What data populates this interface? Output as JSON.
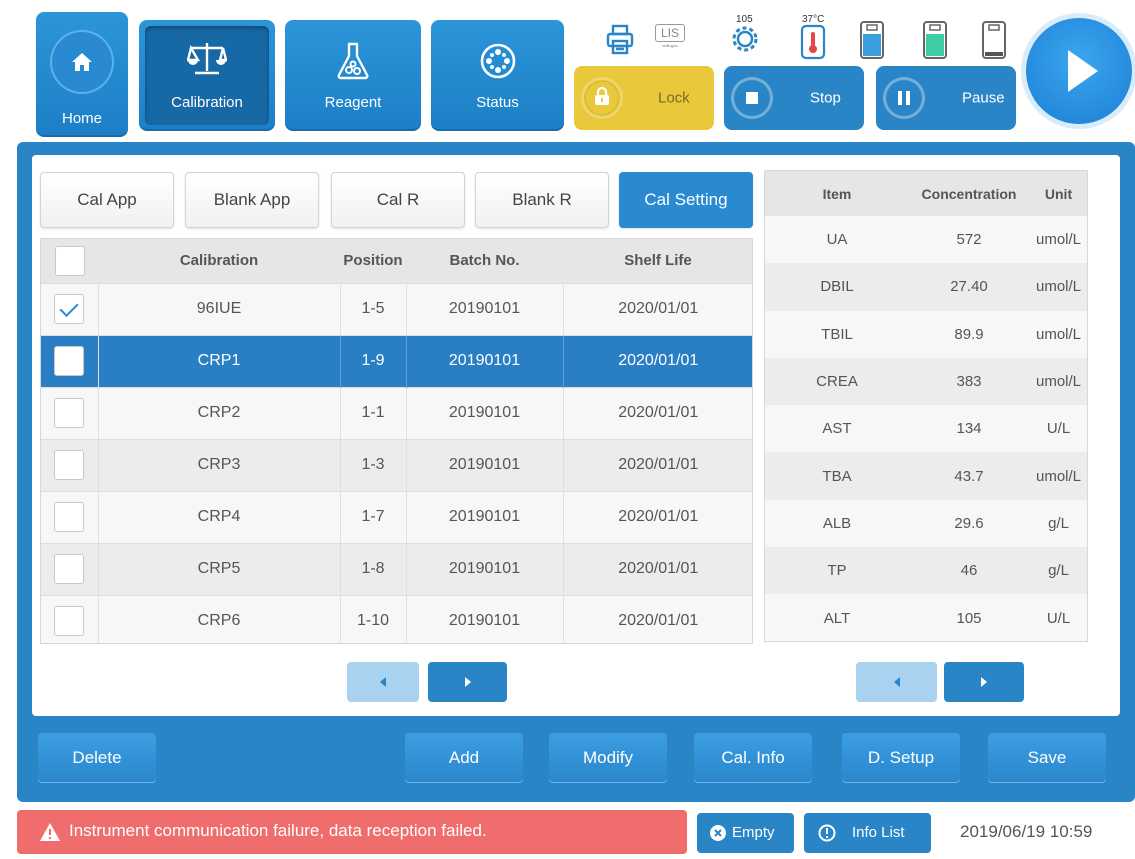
{
  "nav": {
    "home": "Home",
    "calibration": "Calibration",
    "reagent": "Reagent",
    "status": "Status"
  },
  "icons": {
    "lis": "LIS",
    "temp_small": "105",
    "temp_37": "37°C"
  },
  "controls": {
    "lock": "Lock",
    "stop": "Stop",
    "pause": "Pause"
  },
  "tabs": [
    "Cal App",
    "Blank App",
    "Cal R",
    "Blank R",
    "Cal Setting"
  ],
  "cal_table": {
    "headers": [
      "Calibration",
      "Position",
      "Batch No.",
      "Shelf Life"
    ],
    "rows": [
      {
        "name": "96IUE",
        "position": "1-5",
        "batch": "20190101",
        "shelf": "2020/01/01",
        "checked": true
      },
      {
        "name": "CRP1",
        "position": "1-9",
        "batch": "20190101",
        "shelf": "2020/01/01",
        "checked": false
      },
      {
        "name": "CRP2",
        "position": "1-1",
        "batch": "20190101",
        "shelf": "2020/01/01",
        "checked": false
      },
      {
        "name": "CRP3",
        "position": "1-3",
        "batch": "20190101",
        "shelf": "2020/01/01",
        "checked": false
      },
      {
        "name": "CRP4",
        "position": "1-7",
        "batch": "20190101",
        "shelf": "2020/01/01",
        "checked": false
      },
      {
        "name": "CRP5",
        "position": "1-8",
        "batch": "20190101",
        "shelf": "2020/01/01",
        "checked": false
      },
      {
        "name": "CRP6",
        "position": "1-10",
        "batch": "20190101",
        "shelf": "2020/01/01",
        "checked": false
      }
    ]
  },
  "item_table": {
    "headers": [
      "Item",
      "Concentration",
      "Unit"
    ],
    "rows": [
      {
        "item": "UA",
        "conc": "572",
        "unit": "umol/L"
      },
      {
        "item": "DBIL",
        "conc": "27.40",
        "unit": "umol/L"
      },
      {
        "item": "TBIL",
        "conc": "89.9",
        "unit": "umol/L"
      },
      {
        "item": "CREA",
        "conc": "383",
        "unit": "umol/L"
      },
      {
        "item": "AST",
        "conc": "134",
        "unit": "U/L"
      },
      {
        "item": "TBA",
        "conc": "43.7",
        "unit": "umol/L"
      },
      {
        "item": "ALB",
        "conc": "29.6",
        "unit": "g/L"
      },
      {
        "item": "TP",
        "conc": "46",
        "unit": "g/L"
      },
      {
        "item": "ALT",
        "conc": "105",
        "unit": "U/L"
      }
    ]
  },
  "actions": {
    "delete": "Delete",
    "add": "Add",
    "modify": "Modify",
    "cal_info": "Cal. Info",
    "d_setup": "D. Setup",
    "save": "Save"
  },
  "statusbar": {
    "message": "Instrument communication failure, data reception failed.",
    "empty": "Empty",
    "info_list": "Info List",
    "datetime": "2019/06/19 10:59"
  },
  "colors": {
    "accent": "#2a85c7",
    "selected_row": "#2a7fc4",
    "lock": "#e8c93a",
    "alert": "#f06d6d"
  }
}
